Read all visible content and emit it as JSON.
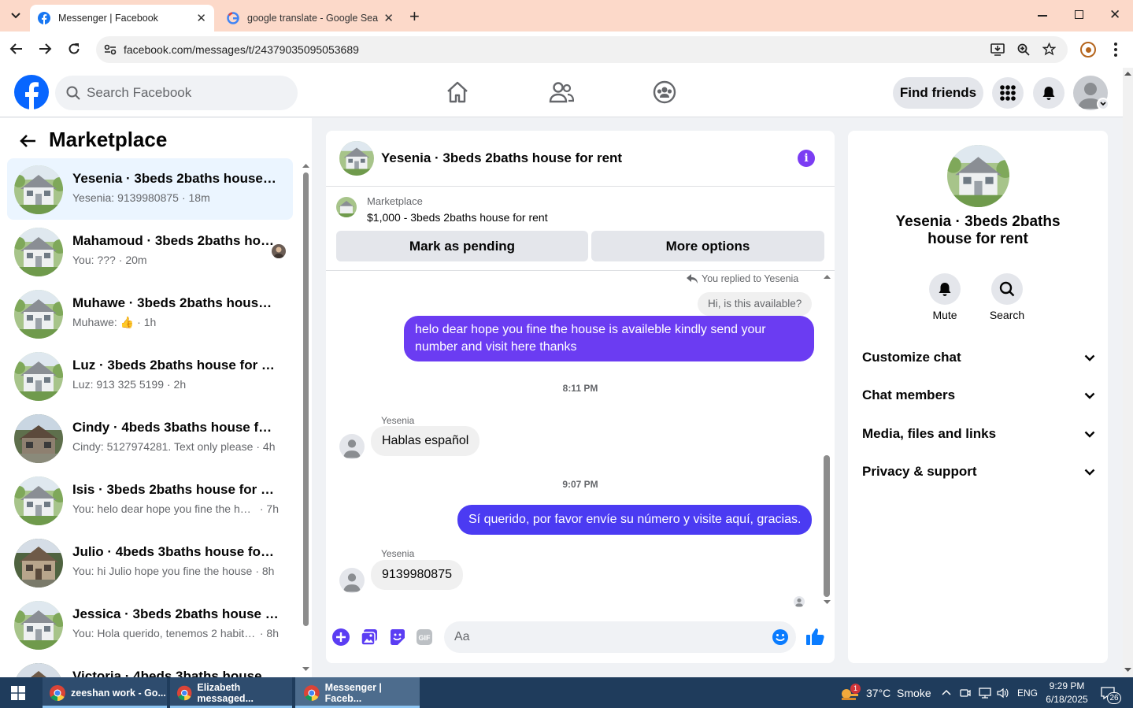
{
  "browser": {
    "tabs": [
      {
        "title": "Messenger | Facebook",
        "icon": "facebook-icon"
      },
      {
        "title": "google translate - Google Search",
        "icon": "google-icon"
      }
    ],
    "url": "facebook.com/messages/t/24379035095053689"
  },
  "fb_header": {
    "search_placeholder": "Search Facebook",
    "find_friends": "Find friends"
  },
  "sidebar": {
    "title": "Marketplace",
    "conversations": [
      {
        "name": "Yesenia · 3beds 2baths house for rent",
        "preview": "Yesenia: 9139980875",
        "time": "· 18m",
        "selected": true,
        "photo": "house"
      },
      {
        "name": "Mahamoud · 3beds 2baths house for rent",
        "preview": "You: ???",
        "time": "· 20m",
        "photo": "house"
      },
      {
        "name": "Muhawe · 3beds 2baths house for rent",
        "preview": "Muhawe: 👍",
        "time": "· 1h",
        "photo": "house"
      },
      {
        "name": "Luz · 3beds 2baths house for rent",
        "preview": "Luz: 913 325 5199",
        "time": "· 2h",
        "photo": "house"
      },
      {
        "name": "Cindy · 4beds 3baths house for rent",
        "preview": "Cindy: 5127974281. Text only please",
        "time": "· 4h",
        "photo": "house2"
      },
      {
        "name": "Isis · 3beds 2baths house for rent",
        "preview": "You: helo dear hope you fine the house",
        "time": "· 7h",
        "photo": "house"
      },
      {
        "name": "Julio · 4beds 3baths house for rent",
        "preview": "You: hi Julio hope you fine the house",
        "time": "· 8h",
        "photo": "house3"
      },
      {
        "name": "Jessica · 3beds 2baths house for rent",
        "preview": "You: Hola querido, tenemos 2 habitaciones",
        "time": "· 8h",
        "photo": "house"
      },
      {
        "name": "Victoria · 4beds 3baths house for rent",
        "preview": "",
        "time": "",
        "photo": "house3"
      }
    ]
  },
  "chat": {
    "title": "Yesenia · 3beds 2baths house for rent",
    "listing_source": "Marketplace",
    "listing": "$1,000 - 3beds 2baths house for rent",
    "mark_pending": "Mark as pending",
    "more_options": "More options",
    "replied_label": "You replied to Yesenia",
    "quoted": "Hi, is this available?",
    "messages": [
      {
        "from": "me",
        "text": "helo dear hope you fine the house is availeble kindly send your number and visit here thanks"
      },
      {
        "type": "time",
        "text": "8:11 PM"
      },
      {
        "from": "Yesenia",
        "text": "Hablas español"
      },
      {
        "type": "time",
        "text": "9:07 PM"
      },
      {
        "from": "me",
        "text": "Sí querido, por favor envíe su número y visite aquí, gracias."
      },
      {
        "from": "Yesenia",
        "text": "9139980875"
      }
    ],
    "input_placeholder": "Aa",
    "accent": "#7b3df3"
  },
  "details": {
    "name": "Yesenia · 3beds 2baths house for rent",
    "mute": "Mute",
    "search": "Search",
    "sections": [
      "Customize chat",
      "Chat members",
      "Media, files and links",
      "Privacy & support"
    ]
  },
  "taskbar": {
    "items": [
      {
        "label": "zeeshan work - Go..."
      },
      {
        "label": "Elizabeth messaged..."
      },
      {
        "label": "Messenger | Faceb...",
        "active": true
      }
    ],
    "weather": "37°C  Smoke",
    "weather_badge": "1",
    "lang": "ENG",
    "time": "9:29 PM",
    "date": "6/18/2025",
    "notif_count": "26"
  }
}
